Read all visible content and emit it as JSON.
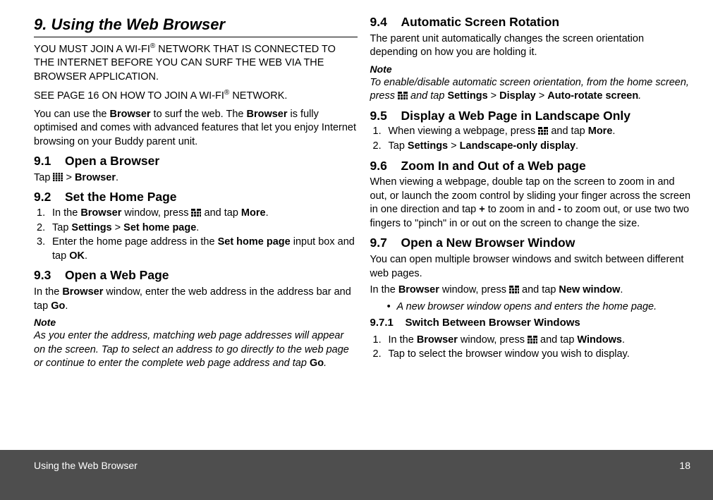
{
  "chapter": {
    "num": "9.",
    "title": "Using the Web Browser"
  },
  "intro1a": "YOU MUST JOIN A WI-FI",
  "intro1b": " NETWORK THAT IS CONNECTED TO THE INTERNET BEFORE YOU CAN SURF THE WEB VIA THE BROWSER APPLICATION.",
  "intro2a": "SEE PAGE 16 ON HOW TO JOIN A WI-FI",
  "intro2b": " NETWORK.",
  "reg": "®",
  "intro3_pre": "You can use the ",
  "intro3_bold1": "Browser",
  "intro3_mid": " to surf the web. The ",
  "intro3_bold2": "Browser",
  "intro3_post": " is fully optimised and comes with advanced features that let you enjoy Internet browsing on your Buddy parent unit.",
  "s91": {
    "num": "9.1",
    "title": "Open a Browser",
    "body_pre": "Tap ",
    "body_mid": " > ",
    "body_bold": "Browser",
    "body_post": "."
  },
  "s92": {
    "num": "9.2",
    "title": "Set the Home Page",
    "li1_pre": "In the ",
    "li1_b1": "Browser",
    "li1_mid": " window, press ",
    "li1_mid2": " and tap ",
    "li1_b2": "More",
    "li1_post": ".",
    "li2_pre": "Tap ",
    "li2_b1": "Settings",
    "li2_gt": " > ",
    "li2_b2": "Set home page",
    "li2_post": ".",
    "li3_pre": "Enter the home page address in the ",
    "li3_b1": "Set home page",
    "li3_mid": " input box and tap ",
    "li3_b2": "OK",
    "li3_post": "."
  },
  "s93": {
    "num": "9.3",
    "title": "Open a Web Page",
    "body_pre": "In the ",
    "body_b": "Browser",
    "body_mid": " window, enter the web address in the address bar and tap ",
    "body_b2": "Go",
    "body_post": ".",
    "note_head": "Note",
    "note_body_pre": "As you enter the address, matching web page addresses will appear on the screen. Tap to select an address to go directly to the web page or continue to enter the complete web page address and tap ",
    "note_b": "Go",
    "note_body_post": "."
  },
  "s94": {
    "num": "9.4",
    "title": "Automatic Screen Rotation",
    "body": "The parent unit automatically changes the screen orientation depending on how you are holding it.",
    "note_head": "Note",
    "note_pre": "To enable/disable automatic screen orientation, from the home screen, press ",
    "note_mid": " and tap ",
    "note_b1": "Settings",
    "note_gt1": " > ",
    "note_b2": "Display",
    "note_gt2": " > ",
    "note_b3": "Auto-rotate screen",
    "note_post": "."
  },
  "s95": {
    "num": "9.5",
    "title": "Display a Web Page in Landscape Only",
    "li1_pre": "When viewing a webpage, press ",
    "li1_mid": " and tap ",
    "li1_b": "More",
    "li1_post": ".",
    "li2_pre": "Tap ",
    "li2_b1": "Settings",
    "li2_gt": " > ",
    "li2_b2": "Landscape-only display",
    "li2_post": "."
  },
  "s96": {
    "num": "9.6",
    "title": "Zoom In and Out of a Web page",
    "body_pre": "When viewing a webpage, double tap on the screen to zoom in and out, or launch the zoom control by sliding your finger across the screen in one direction and tap ",
    "body_b1": "+",
    "body_mid": " to zoom in and ",
    "body_b2": "-",
    "body_post": " to zoom out, or use two two fingers to \"pinch\" in or out on the screen to change the size."
  },
  "s97": {
    "num": "9.7",
    "title": "Open a New Browser Window",
    "body": "You can open multiple browser windows and switch between different web pages.",
    "body2_pre": "In the ",
    "body2_b1": "Browser",
    "body2_mid": " window, press ",
    "body2_mid2": " and tap ",
    "body2_b2": "New window",
    "body2_post": ".",
    "bullet": "A new browser window opens and enters the home page."
  },
  "s971": {
    "num": "9.7.1",
    "title": "Switch Between Browser Windows",
    "li1_pre": "In the ",
    "li1_b1": "Browser",
    "li1_mid": " window, press ",
    "li1_mid2": " and tap ",
    "li1_b2": "Windows",
    "li1_post": ".",
    "li2": "Tap to select the browser window you wish to display."
  },
  "list_num": {
    "n1": "1.",
    "n2": "2.",
    "n3": "3."
  },
  "bullet_char": "•",
  "footer": {
    "title": "Using the Web Browser",
    "page": "18"
  }
}
